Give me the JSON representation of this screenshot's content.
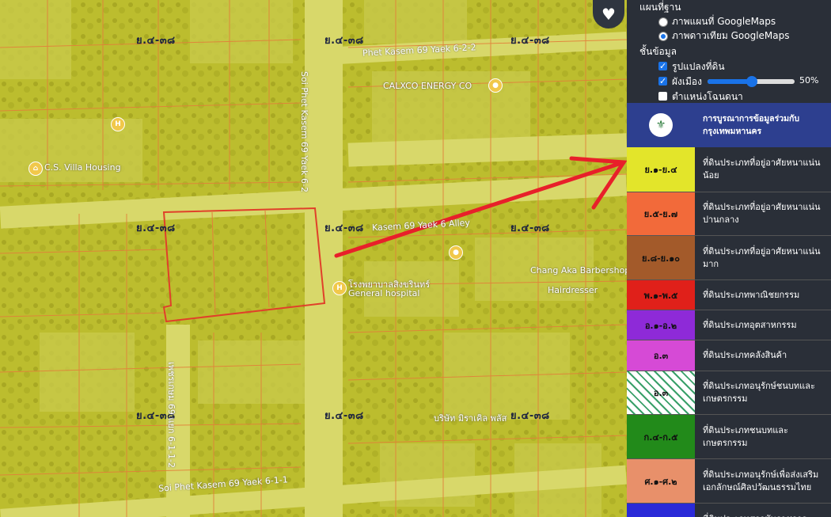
{
  "map": {
    "zone_labels": [
      "ย.๔-๓๘",
      "ย.๔-๓๘",
      "ย.๔-๓๘",
      "ย.๔-๓๘",
      "ย.๔-๓๘",
      "ย.๔-๓๘",
      "ย.๔-๓๘",
      "ย.๔-๓๘",
      "ย.๔-๓๘"
    ],
    "roads": {
      "top": "Phet Kasem 69 Yaek 6-2-2",
      "vertical": "Soi Phet Kasem 69 Yaek 6-2",
      "middle": "Kasem 69 Yaek 6 Alley",
      "bottom": "Soi Phet Kasem 69 Yaek 6-1-1",
      "lower_vertical": "เพชรเกษม 69 แยก 6-1-1-2"
    },
    "pois": {
      "villa": "C.S. Villa Housing",
      "calxco": "CALXCO ENERGY CO",
      "hospital": "โรงพยาบาลสิงขรินทร์",
      "hospital_en": "General hospital",
      "barber": "Chang Aka Barbershop By vinta",
      "hairdresser": "Hairdresser",
      "company": "บริษัท มิราเคิล พลัส"
    },
    "overlay_color": "#d4d42a",
    "parcel_color": "#e0402a",
    "arrow_color": "#e8202a"
  },
  "favorite_icon": "heart-icon",
  "panel": {
    "basemap_title": "แผนที่ฐาน",
    "basemap_options": [
      "ภาพแผนที่ GoogleMaps",
      "ภาพดาวเทียม GoogleMaps"
    ],
    "basemap_selected": 1,
    "layers_title": "ชั้นข้อมูล",
    "layers": [
      {
        "label": "รูปแปลงที่ดิน",
        "checked": true
      },
      {
        "label": "ผังเมือง",
        "checked": true
      },
      {
        "label": "ตำแหน่งโฉนดนา",
        "checked": false
      }
    ],
    "opacity_value": "50%",
    "opacity": 0.5,
    "bma_title": "การบูรณาการข้อมูลร่วมกับ กรุงเทพมหานคร",
    "legend": [
      {
        "code": "ย.๑-ย.๔",
        "color": "#e3e52a",
        "desc": "ที่ดินประเภทที่อยู่อาศัยหนาแน่นน้อย"
      },
      {
        "code": "ย.๕-ย.๗",
        "color": "#f26a3a",
        "desc": "ที่ดินประเภทที่อยู่อาศัยหนาแน่นปานกลาง"
      },
      {
        "code": "ย.๘-ย.๑๐",
        "color": "#a35a2a",
        "desc": "ที่ดินประเภทที่อยู่อาศัยหนาแน่นมาก"
      },
      {
        "code": "พ.๑-พ.๕",
        "color": "#e0201a",
        "desc": "ที่ดินประเภทพาณิชยกรรม"
      },
      {
        "code": "อ.๑-อ.๒",
        "color": "#8e2ad8",
        "desc": "ที่ดินประเภทอุตสาหกรรม"
      },
      {
        "code": "อ.๓",
        "color": "#d64ad6",
        "desc": "ที่ดินประเภทคลังสินค้า"
      },
      {
        "code": "อ.๓",
        "color": "#ffffff",
        "desc": "ที่ดินประเภทอนุรักษ์ชนบทและเกษตรกรรม"
      },
      {
        "code": "ก.๔-ก.๕",
        "color": "#228a1a",
        "desc": "ที่ดินประเภทชนบทและเกษตรกรรม"
      },
      {
        "code": "ศ.๑-ศ.๒",
        "color": "#e8906a",
        "desc": "ที่ดินประเภทอนุรักษ์เพื่อส่งเสริมเอกลักษณ์ศิลปวัฒนธรรมไทย"
      },
      {
        "code": "",
        "color": "#2a2ad8",
        "desc": "ที่ดินประเภทสถาบันราชการ"
      }
    ]
  }
}
